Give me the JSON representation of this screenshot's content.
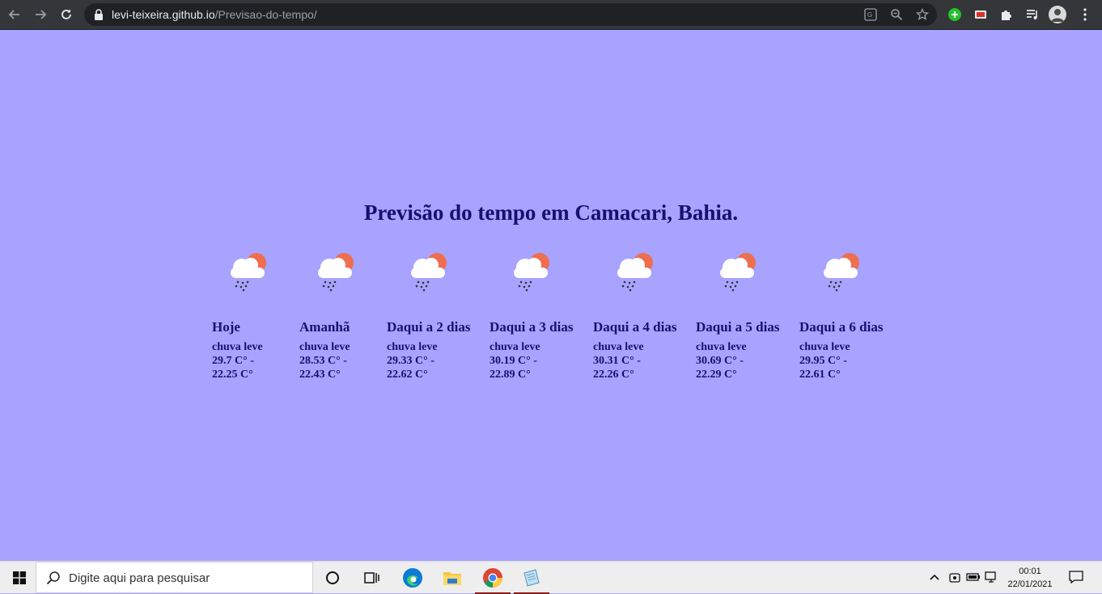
{
  "browser": {
    "url_host": "levi-teixeira.github.io",
    "url_path": "/Previsao-do-tempo/"
  },
  "page": {
    "title": "Previsão do tempo em Camacari, Bahia.",
    "icon": "light-rain-cloud-sun-icon",
    "days": [
      {
        "label": "Hoje",
        "desc": "chuva leve",
        "temp_max": "29.7 C° -",
        "temp_min": "22.25 C°"
      },
      {
        "label": "Amanhã",
        "desc": "chuva leve",
        "temp_max": "28.53 C° -",
        "temp_min": "22.43 C°"
      },
      {
        "label": "Daqui a 2 dias",
        "desc": "chuva leve",
        "temp_max": "29.33 C° -",
        "temp_min": "22.62 C°"
      },
      {
        "label": "Daqui a 3 dias",
        "desc": "chuva leve",
        "temp_max": "30.19 C° -",
        "temp_min": "22.89 C°"
      },
      {
        "label": "Daqui a 4 dias",
        "desc": "chuva leve",
        "temp_max": "30.31 C° -",
        "temp_min": "22.26 C°"
      },
      {
        "label": "Daqui a 5 dias",
        "desc": "chuva leve",
        "temp_max": "30.69 C° -",
        "temp_min": "22.29 C°"
      },
      {
        "label": "Daqui a 6 dias",
        "desc": "chuva leve",
        "temp_max": "29.95 C° -",
        "temp_min": "22.61 C°"
      }
    ]
  },
  "taskbar": {
    "search_placeholder": "Digite aqui para pesquisar",
    "time": "00:01",
    "date": "22/01/2021"
  },
  "colors": {
    "page_background": "#a8a3ff",
    "text": "#14126b",
    "chrome_toolbar": "#35363a"
  }
}
